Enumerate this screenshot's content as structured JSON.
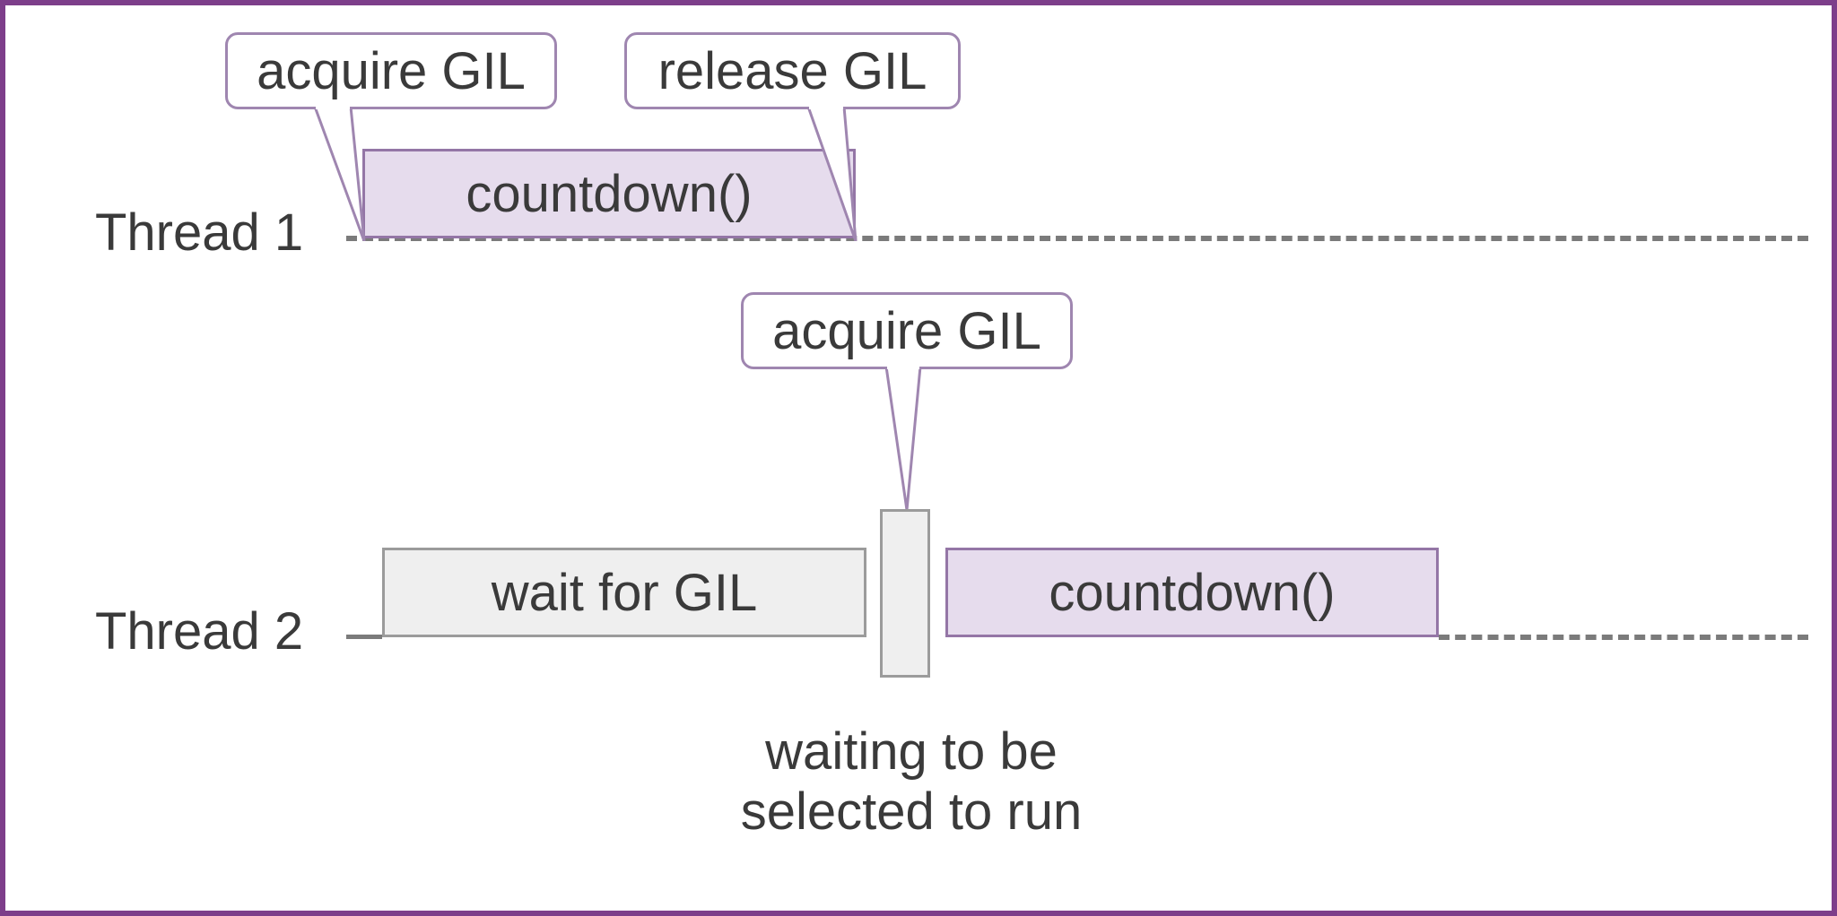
{
  "threads": {
    "t1_label": "Thread 1",
    "t2_label": "Thread 2"
  },
  "callouts": {
    "acquire_top": "acquire GIL",
    "release_top": "release GIL",
    "acquire_mid": "acquire GIL"
  },
  "boxes": {
    "t1_countdown": "countdown()",
    "t2_wait": "wait for GIL",
    "t2_countdown": "countdown()"
  },
  "footer": {
    "line1": "waiting to be",
    "line2": "selected to run"
  }
}
